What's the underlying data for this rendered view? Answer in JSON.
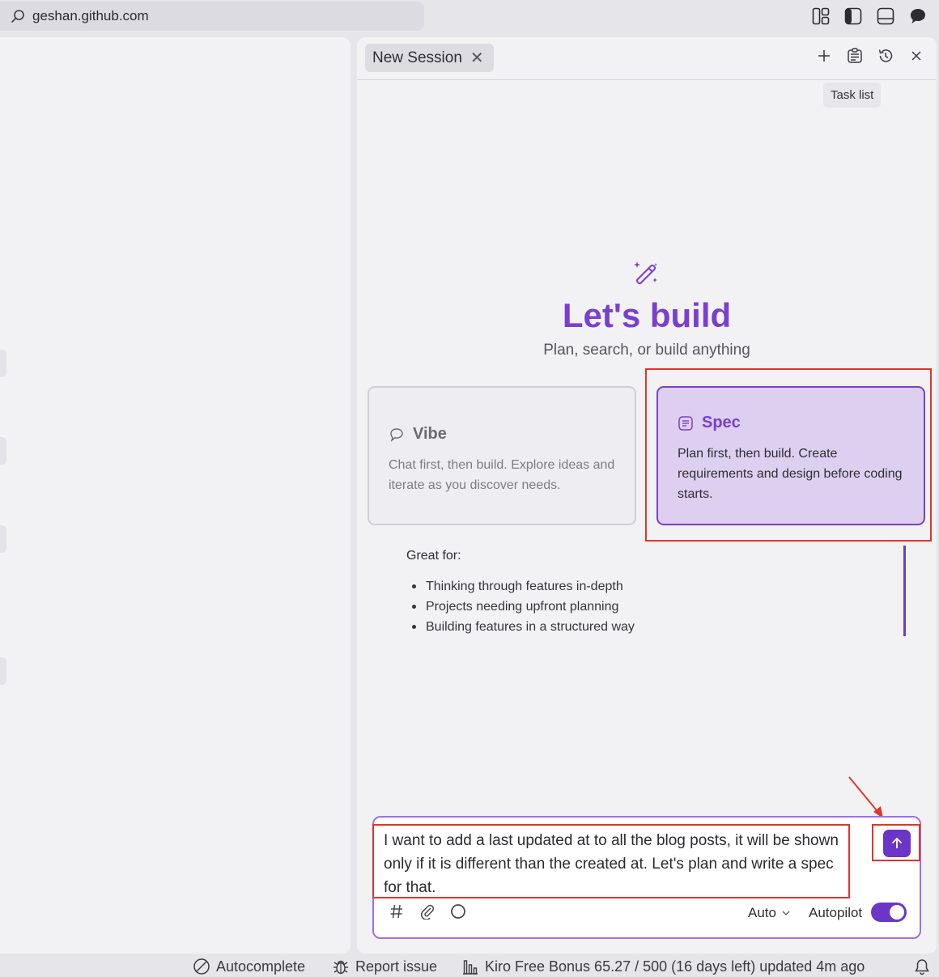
{
  "browser": {
    "url": "geshan.github.com",
    "icons": [
      "search-icon",
      "layout-grid-icon",
      "sidebar-left-icon",
      "panel-bottom-icon",
      "chat-bubble-icon"
    ]
  },
  "session": {
    "tab_label": "New Session",
    "close_glyph": "✕",
    "actions": [
      "plus-icon",
      "task-list-icon",
      "history-icon",
      "close-icon"
    ],
    "tooltip": "Task list"
  },
  "hero": {
    "icon": "magic-wand-icon",
    "title": "Let's build",
    "subtitle": "Plan, search, or build anything"
  },
  "cards": {
    "vibe": {
      "name": "Vibe",
      "icon": "chat-bubble-icon",
      "description": "Chat first, then build. Explore ideas and iterate as you discover needs."
    },
    "spec": {
      "name": "Spec",
      "icon": "document-lines-icon",
      "description": "Plan first, then build. Create requirements and design before coding starts.",
      "selected": true
    }
  },
  "great_for": {
    "heading": "Great for:",
    "items": [
      "Thinking through features in-depth",
      "Projects needing upfront planning",
      "Building features in a structured way"
    ]
  },
  "chat": {
    "input_text": "I want to add a last updated at to all the blog posts, it will be shown only if it is different than the created at. Let's plan and write a spec for that.",
    "tools": [
      "hash-icon",
      "paperclip-icon",
      "circle-icon"
    ],
    "mode": "Auto",
    "autopilot_label": "Autopilot",
    "autopilot_on": true,
    "send_icon": "arrow-up-icon"
  },
  "statusbar": {
    "autocomplete": "Autocomplete",
    "report_issue": "Report issue",
    "usage": "Kiro Free Bonus 65.27 / 500 (16 days left) updated 4m ago",
    "bell_icon": "bell-icon"
  },
  "colors": {
    "accent": "#7a3fd1",
    "accent_dark": "#6b35c8",
    "spec_card_bg": "#dccff0",
    "annotation_red": "#e0352b"
  }
}
